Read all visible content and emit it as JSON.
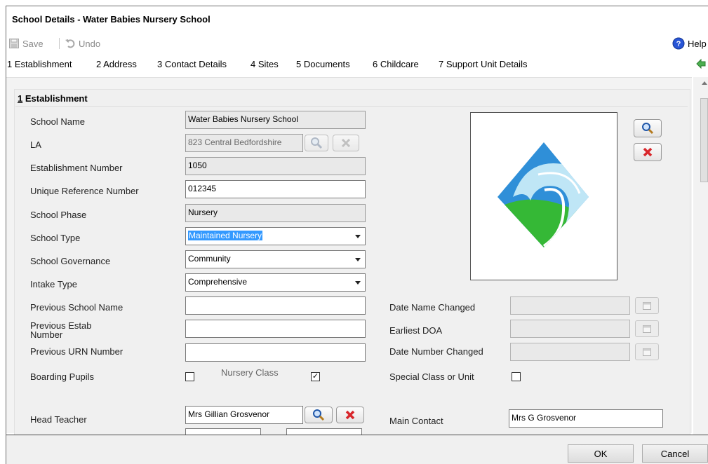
{
  "window": {
    "title": "School Details - Water Babies Nursery School"
  },
  "toolbar": {
    "save_label": "Save",
    "undo_label": "Undo",
    "help_label": "Help"
  },
  "tabs": [
    "1 Establishment",
    "2 Address",
    "3 Contact Details",
    "4 Sites",
    "5 Documents",
    "6 Childcare",
    "7 Support Unit Details"
  ],
  "section": {
    "number": "1",
    "title": " Establishment"
  },
  "fields": {
    "school_name": {
      "label": "School Name",
      "value": "Water Babies Nursery School"
    },
    "la": {
      "label": "LA",
      "value": "823 Central Bedfordshire"
    },
    "establishment_number": {
      "label": "Establishment Number",
      "value": "1050"
    },
    "urn": {
      "label": "Unique Reference Number",
      "value": "012345"
    },
    "school_phase": {
      "label": "School Phase",
      "value": "Nursery"
    },
    "school_type": {
      "label": "School Type",
      "value": "Maintained Nursery"
    },
    "school_governance": {
      "label": "School Governance",
      "value": "Community"
    },
    "intake_type": {
      "label": "Intake Type",
      "value": "Comprehensive"
    },
    "previous_school_name": {
      "label": "Previous School Name",
      "value": ""
    },
    "previous_estab_number": {
      "label_line1": "Previous Estab",
      "label_line2": "Number",
      "value": ""
    },
    "previous_urn": {
      "label": "Previous URN Number",
      "value": ""
    },
    "boarding_pupils": {
      "label": "Boarding Pupils",
      "checked": false
    },
    "nursery_class": {
      "label": "Nursery Class",
      "checked": true
    },
    "date_name_changed": {
      "label": "Date Name Changed",
      "value": ""
    },
    "earliest_doa": {
      "label": "Earliest DOA",
      "value": ""
    },
    "date_number_changed": {
      "label": "Date Number Changed",
      "value": ""
    },
    "special_class": {
      "label": "Special Class or Unit",
      "checked": false
    },
    "head_teacher": {
      "label": "Head Teacher",
      "value": "Mrs Gillian Grosvenor"
    },
    "main_contact": {
      "label": "Main Contact",
      "value": "Mrs G Grosvenor"
    }
  },
  "buttons": {
    "ok": "OK",
    "cancel": "Cancel"
  },
  "icons": {
    "search": "magnifier-icon",
    "clear": "red-x-icon",
    "calendar": "calendar-icon",
    "help": "help-icon",
    "save": "save-icon",
    "undo": "undo-icon",
    "logo": "wave-logo"
  },
  "colors": {
    "selection": "#3399ff",
    "panel": "#f0f0f0",
    "logo_blue": "#2f8fd8",
    "logo_green": "#35b836"
  }
}
